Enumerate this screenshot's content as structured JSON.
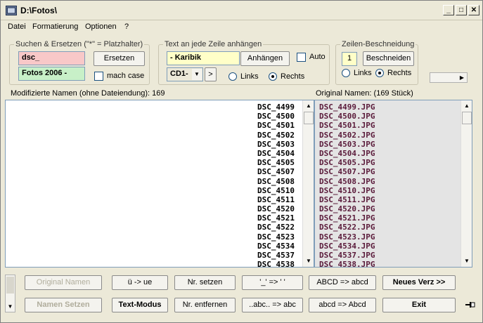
{
  "window": {
    "title": "D:\\Fotos\\",
    "min": "_",
    "max": "□",
    "close": "✕"
  },
  "menu": [
    {
      "label": "Datei"
    },
    {
      "label": "Formatierung"
    },
    {
      "label": "Optionen"
    },
    {
      "label": "?"
    }
  ],
  "search": {
    "group_label": "Suchen & Ersetzen (\"*\" = Platzhalter)",
    "find_value": "dsc_",
    "replace_value": "Fotos 2006 -",
    "replace_button": "Ersetzen",
    "match_case_label": "mach case",
    "match_case_checked": false,
    "find_bg": "#f8c8c8",
    "replace_bg": "#c8f0c8"
  },
  "append": {
    "group_label": "Text an jede Zeile anhängen",
    "text_value": "- Karibik",
    "text_bg": "#ffffc8",
    "append_button": "Anhängen",
    "auto_label": "Auto",
    "auto_checked": false,
    "combo_value": "CD1-",
    "arrow_button": ">",
    "left_label": "Links",
    "right_label": "Rechts",
    "selected": "Rechts"
  },
  "trim": {
    "group_label": "Zeilen-Beschneidung",
    "count": "1",
    "trim_button": "Beschneiden",
    "left_label": "Links",
    "right_label": "Rechts",
    "selected": "Rechts"
  },
  "modified": {
    "header": "Modifizierte Namen  (ohne Dateiendung): 169",
    "items": [
      "DSC_4499",
      "DSC_4500",
      "DSC_4501",
      "DSC_4502",
      "DSC_4503",
      "DSC_4504",
      "DSC_4505",
      "DSC_4507",
      "DSC_4508",
      "DSC_4510",
      "DSC_4511",
      "DSC_4520",
      "DSC_4521",
      "DSC_4522",
      "DSC_4523",
      "DSC_4534",
      "DSC_4537",
      "DSC_4538"
    ]
  },
  "original": {
    "header": "Original Namen:  (169 Stück)",
    "items": [
      "DSC_4499.JPG",
      "DSC_4500.JPG",
      "DSC_4501.JPG",
      "DSC_4502.JPG",
      "DSC_4503.JPG",
      "DSC_4504.JPG",
      "DSC_4505.JPG",
      "DSC_4507.JPG",
      "DSC_4508.JPG",
      "DSC_4510.JPG",
      "DSC_4511.JPG",
      "DSC_4520.JPG",
      "DSC_4521.JPG",
      "DSC_4522.JPG",
      "DSC_4523.JPG",
      "DSC_4534.JPG",
      "DSC_4537.JPG",
      "DSC_4538.JPG"
    ],
    "text_color": "#5a1a3a"
  },
  "buttons": {
    "original_names": "Original Namen",
    "set_names": "Namen Setzen",
    "ue": "ü -> ue",
    "text_mode": "Text-Modus",
    "set_nr": "Nr. setzen",
    "remove_nr": "Nr. entfernen",
    "underscore": "'_' => ' '",
    "abc_trim": "..abc..  =>  abc",
    "lower": "ABCD => abcd",
    "capitalize": "abcd => Abcd",
    "new_dir": "Neues Verz >>",
    "exit": "Exit"
  },
  "icons": {
    "app": "folder-app-icon",
    "pin": "pin-icon"
  }
}
